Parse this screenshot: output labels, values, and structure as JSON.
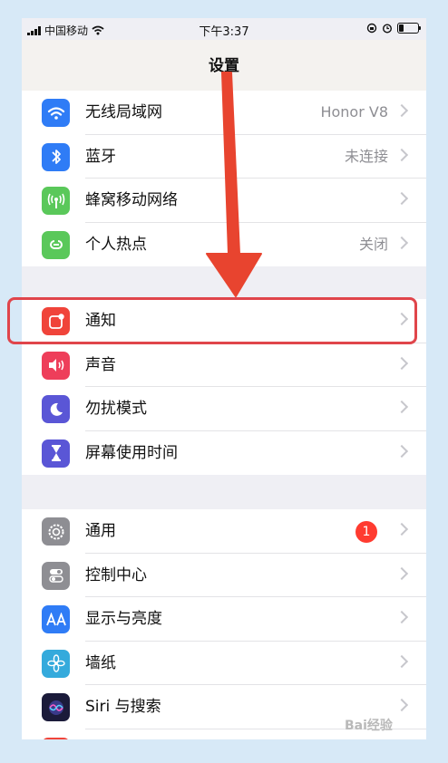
{
  "status_bar": {
    "carrier": "中国移动",
    "time": "下午3:37",
    "battery_level": 0.3
  },
  "nav": {
    "title": "设置"
  },
  "groups": [
    {
      "rows": [
        {
          "label": "无线局域网",
          "value": "Honor V8",
          "icon": "wifi-icon",
          "color": "#2f7cf6"
        },
        {
          "label": "蓝牙",
          "value": "未连接",
          "icon": "bluetooth-icon",
          "color": "#2f7cf6"
        },
        {
          "label": "蜂窝移动网络",
          "value": "",
          "icon": "cellular-icon",
          "color": "#5ac85a"
        },
        {
          "label": "个人热点",
          "value": "关闭",
          "icon": "hotspot-icon",
          "color": "#5ac85a"
        }
      ]
    },
    {
      "rows": [
        {
          "label": "通知",
          "value": "",
          "icon": "notifications-icon",
          "color": "#f0443a"
        },
        {
          "label": "声音",
          "value": "",
          "icon": "sound-icon",
          "color": "#ee3e5a"
        },
        {
          "label": "勿扰模式",
          "value": "",
          "icon": "moon-icon",
          "color": "#5a56d6"
        },
        {
          "label": "屏幕使用时间",
          "value": "",
          "icon": "hourglass-icon",
          "color": "#5a56d6"
        }
      ]
    },
    {
      "rows": [
        {
          "label": "通用",
          "value": "",
          "badge": "1",
          "icon": "gear-icon",
          "color": "#8e8e93"
        },
        {
          "label": "控制中心",
          "value": "",
          "icon": "toggles-icon",
          "color": "#8e8e93"
        },
        {
          "label": "显示与亮度",
          "value": "",
          "icon": "text-size-icon",
          "color": "#2f7cf6"
        },
        {
          "label": "墙纸",
          "value": "",
          "icon": "flower-icon",
          "color": "#34aadc"
        },
        {
          "label": "Siri 与搜索",
          "value": "",
          "icon": "siri-icon",
          "color": "#1b1b3a"
        }
      ]
    }
  ],
  "annotation": {
    "color": "#e0454b"
  },
  "watermark": "Bai经验"
}
